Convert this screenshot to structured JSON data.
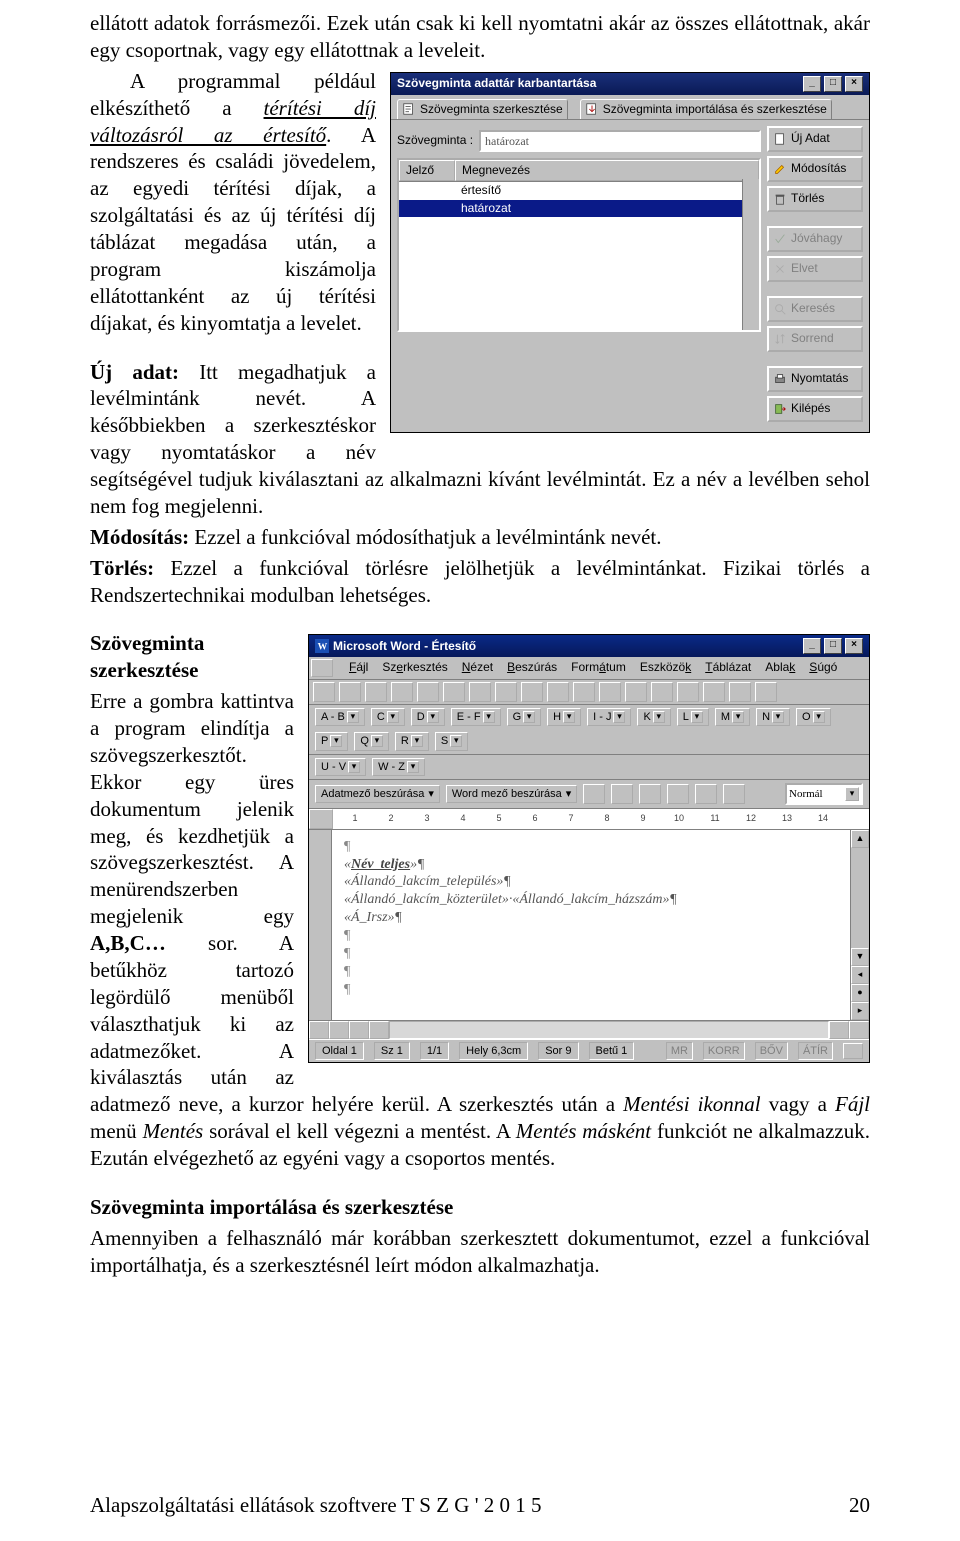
{
  "body": {
    "p1": "ellátott adatok forrásmezői. Ezek után csak ki kell nyomtatni akár az összes ellátottnak, akár egy csoportnak, vagy egy ellátottnak a leveleit.",
    "p2_a": "A programmal például elkészíthető a ",
    "p2_link": "térítési díj változásról az értesítő",
    "p2_b": ". A rendszeres és családi jövedelem, az egyedi térítési díjak, a szolgáltatási és az új térítési díj táblázat megadása után, a program kiszámolja ellátottanként az új térítési díjakat, és kinyomtatja a levelet.",
    "p3_a": "Új adat:",
    "p3_b": " Itt megadhatjuk a levélmintánk nevét. A későbbiekben a szerkesztéskor vagy nyomtatáskor a név segítségével tudjuk kiválasztani az alkalmazni kívánt levélmintát. Ez a név a levélben sehol nem fog megjelenni.",
    "p4_a": "Módosítás:",
    "p4_b": " Ezzel a funkcióval módosíthatjuk a levélmintánk nevét.",
    "p5_a": "Törlés:",
    "p5_b": " Ezzel a funkcióval törlésre jelölhetjük a levélmintánkat. Fizikai törlés a Rendszertechnikai modulban lehetséges.",
    "p6_head": "Szövegminta szerkesztése",
    "p6_a": "Erre a gombra kattintva a program elindítja a szövegszerkesztőt. Ekkor egy üres dokumentum jelenik meg, és kezdhetjük a szövegszerkesztést. A menürendszerben megjelenik egy ",
    "p6_abc": "A,B,C…",
    "p6_b": " sor. A betűkhöz tartozó legördülő menüből választhatjuk ki az adatmezőket. A kiválasztás után az adatmező neve, a kurzor helyére kerül. A szerkesztés után a ",
    "p6_mi": "Mentési ikonnal",
    "p6_c": " vagy a ",
    "p6_fajl": "Fájl",
    "p6_d": " menü ",
    "p6_mentes": "Mentés",
    "p6_e": " sorával el kell végezni a mentést. A ",
    "p6_mm": "Mentés másként",
    "p6_f": " funkciót ne alkalmazzuk. Ezután elvégezhető az egyéni vagy a csoportos mentés.",
    "p7_head": "Szövegminta importálása és szerkesztése",
    "p7": "Amennyiben a felhasználó már korábban szerkesztett dokumentumot, ezzel a funkcióval importálhatja, és a szerkesztésnél leírt módon alkalmazhatja."
  },
  "ss1": {
    "title": "Szövegminta adattár karbantartása",
    "tab1": "Szövegminta szerkesztése",
    "tab2": "Szövegminta importálása és szerkesztése",
    "field_label": "Szövegminta :",
    "field_value": "határozat",
    "col1": "Jelző",
    "col2": "Megnevezés",
    "row1": "értesítő",
    "row2": "határozat",
    "buttons": {
      "ujadat": "Új Adat",
      "modositas": "Módosítás",
      "torles": "Törlés",
      "jovahagy": "Jóváhagy",
      "elvet": "Elvet",
      "kereses": "Keresés",
      "sorrend": "Sorrend",
      "nyomtatas": "Nyomtatás",
      "kilepes": "Kilépés"
    },
    "sys": {
      "min": "_",
      "max": "□",
      "close": "×"
    }
  },
  "ss2": {
    "title": "Microsoft Word - Értesítő",
    "menus": [
      "Fájl",
      "Szerkesztés",
      "Nézet",
      "Beszúrás",
      "Formátum",
      "Eszközök",
      "Táblázat",
      "Ablak",
      "Súgó"
    ],
    "letters": [
      "A - B",
      "C",
      "D",
      "E - F",
      "G",
      "H",
      "I - J",
      "K",
      "L",
      "M",
      "N",
      "O",
      "P",
      "Q",
      "R",
      "S"
    ],
    "letters2": [
      "U - V",
      "W - Z"
    ],
    "fieldbar": {
      "a": "Adatmező beszúrása",
      "b": "Word mező beszúrása"
    },
    "style_sel": "Normál",
    "ruler": [
      "1",
      "2",
      "3",
      "4",
      "5",
      "6",
      "7",
      "8",
      "9",
      "10",
      "11",
      "12",
      "13",
      "14"
    ],
    "doc_lines": {
      "l1": "¶",
      "l2a": "«",
      "l2b": "Név_teljes",
      "l2c": "»¶",
      "l3": "«Állandó_lakcím_település»¶",
      "l4": "«Állandó_lakcím_közterület»·«Állandó_lakcím_házszám»¶",
      "l5": "«Á_Irsz»¶",
      "l6": "¶",
      "l7": "¶",
      "l8": "¶",
      "l9": "¶"
    },
    "status": {
      "oldal": "Oldal  1",
      "sz": "Sz  1",
      "frac": "1/1",
      "hely": "Hely  6,3cm",
      "sor": "Sor  9",
      "betu": "Betű  1",
      "modes": [
        "MR",
        "KORR",
        "BŐV",
        "ÁTÍR"
      ]
    },
    "sys": {
      "min": "_",
      "max": "□",
      "close": "×"
    }
  },
  "footer": {
    "left": "Alapszolgáltatási ellátások szoftvere   T S Z G   ' 2 0 1 5",
    "right": "20"
  }
}
